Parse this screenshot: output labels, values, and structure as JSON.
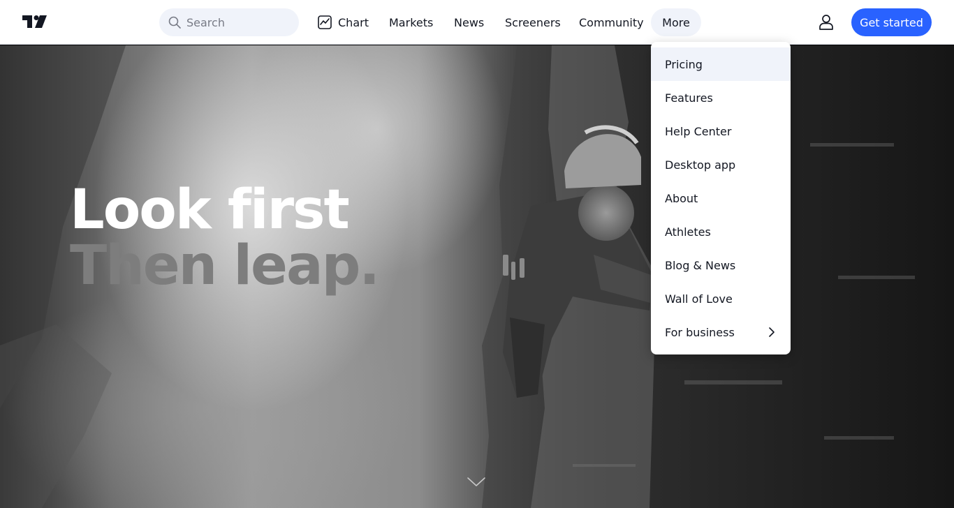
{
  "header": {
    "search": {
      "placeholder": "Search",
      "icon": "search-icon"
    },
    "nav": [
      {
        "label": "Chart",
        "icon": "chart-icon"
      },
      {
        "label": "Markets"
      },
      {
        "label": "News"
      },
      {
        "label": "Screeners"
      },
      {
        "label": "Community"
      },
      {
        "label": "More",
        "state": "open"
      }
    ],
    "user_icon": "user-icon",
    "cta_label": "Get started"
  },
  "more_menu": {
    "items": [
      {
        "label": "Pricing",
        "highlighted": true
      },
      {
        "label": "Features"
      },
      {
        "label": "Help Center"
      },
      {
        "label": "Desktop app"
      },
      {
        "label": "About"
      },
      {
        "label": "Athletes"
      },
      {
        "label": "Blog & News"
      },
      {
        "label": "Wall of Love"
      },
      {
        "label": "For business",
        "submenu_icon": "chevron-right-icon"
      }
    ]
  },
  "hero": {
    "headline_line1": "Look first",
    "headline_line2": "Then leap.",
    "scroll_icon": "chevron-down-icon"
  },
  "colors": {
    "accent": "#2962ff",
    "nav_text": "#131722",
    "pill_bg": "#f0f3fa",
    "muted_text": "#787b86",
    "headline_secondary": "#7d7d7d"
  }
}
